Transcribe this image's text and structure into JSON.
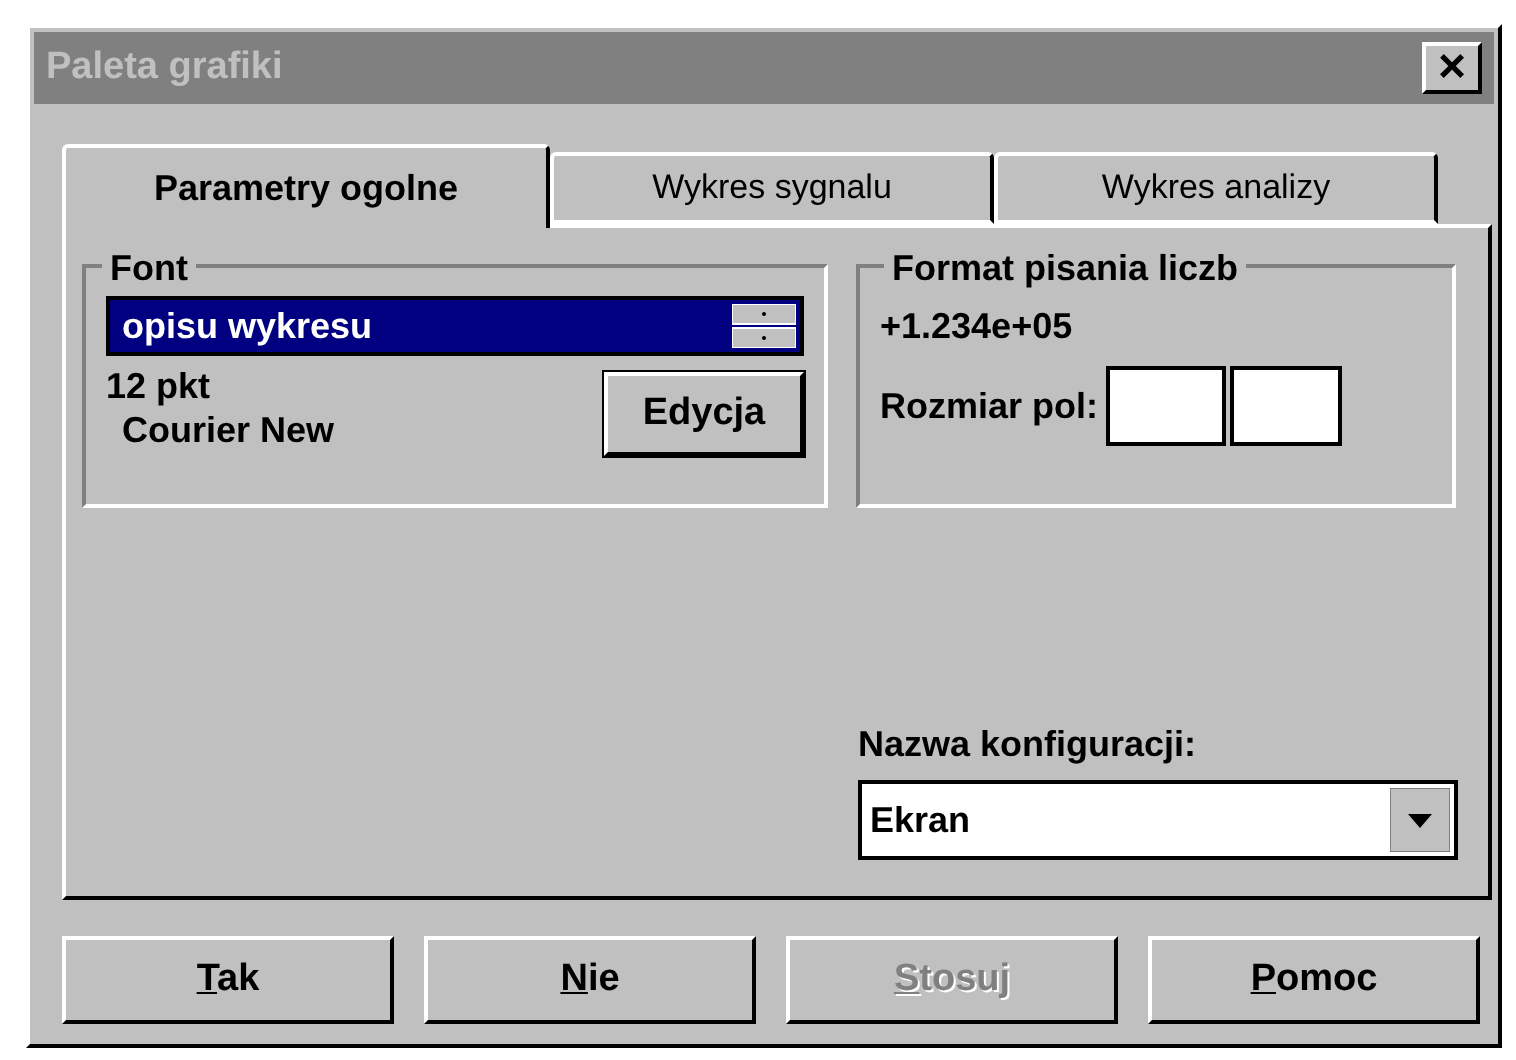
{
  "window": {
    "title": "Paleta grafiki",
    "close": "×",
    "active": false
  },
  "tabs": [
    {
      "label": "Parametry ogolne",
      "selected": true
    },
    {
      "label": "Wykres sygnalu",
      "selected": false
    },
    {
      "label": "Wykres analizy",
      "selected": false
    }
  ],
  "font_group": {
    "title": "Font",
    "selector": {
      "value": "opisu wykresu",
      "selected": true
    },
    "size": "12 pkt",
    "name": "Courier New",
    "button": "Edycja"
  },
  "number_format_group": {
    "title": "Format pisania liczb",
    "example": "+1.234e+05",
    "field_size_label": "Rozmiar pol:"
  },
  "configuration": {
    "label": "Nazwa konfiguracji:",
    "value": "Ekran"
  },
  "buttons": [
    {
      "accel": "T",
      "rest": "ak",
      "disabled": false
    },
    {
      "accel": "N",
      "rest": "ie",
      "disabled": false
    },
    {
      "accel": "S",
      "rest": "tosuj",
      "disabled": true
    },
    {
      "accel": "P",
      "rest": "omoc",
      "disabled": false
    }
  ]
}
